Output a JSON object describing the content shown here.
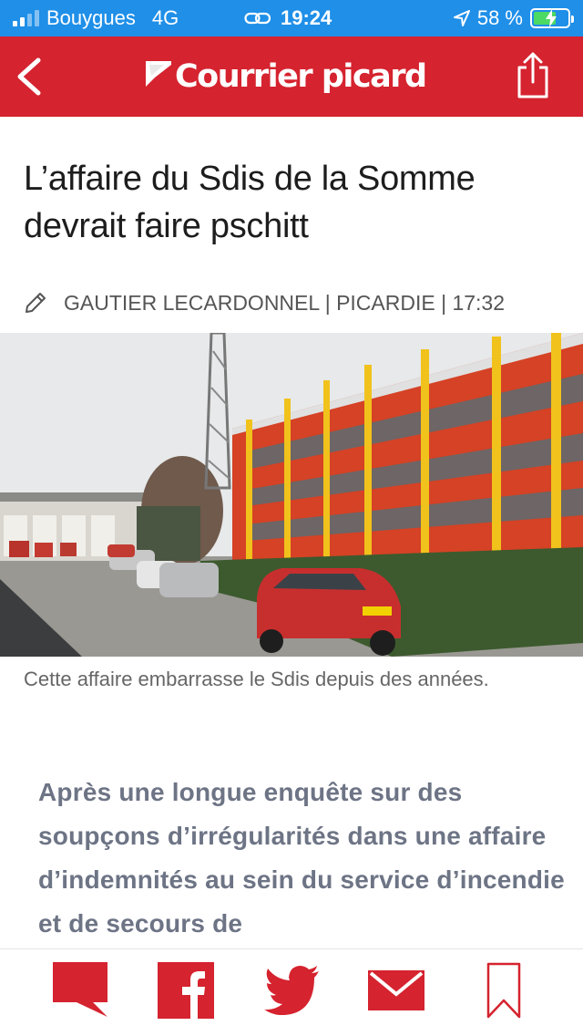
{
  "status_bar": {
    "carrier": "Bouygues",
    "network": "4G",
    "time": "19:24",
    "battery_percent": "58 %",
    "battery_level": 0.58,
    "charging": true
  },
  "header": {
    "brand": "Courrier picard",
    "back_icon": "chevron-left-icon",
    "share_icon": "share-icon",
    "color": "#d5232f"
  },
  "article": {
    "title": "L’affaire du Sdis de la Somme devrait faire pschitt",
    "byline": "GAUTIER LECARDONNEL | PICARDIE | 17:32",
    "caption": "Cette affaire embarrasse le Sdis depuis des années.",
    "lead": "Après une longue enquête sur des soupçons d’irrégularités dans une affaire d’indemnités au sein du service d’incendie et de secours de"
  },
  "toolbar": {
    "items": [
      "comment-icon",
      "facebook-icon",
      "twitter-icon",
      "mail-icon",
      "bookmark-icon"
    ],
    "accent": "#d5232f"
  }
}
